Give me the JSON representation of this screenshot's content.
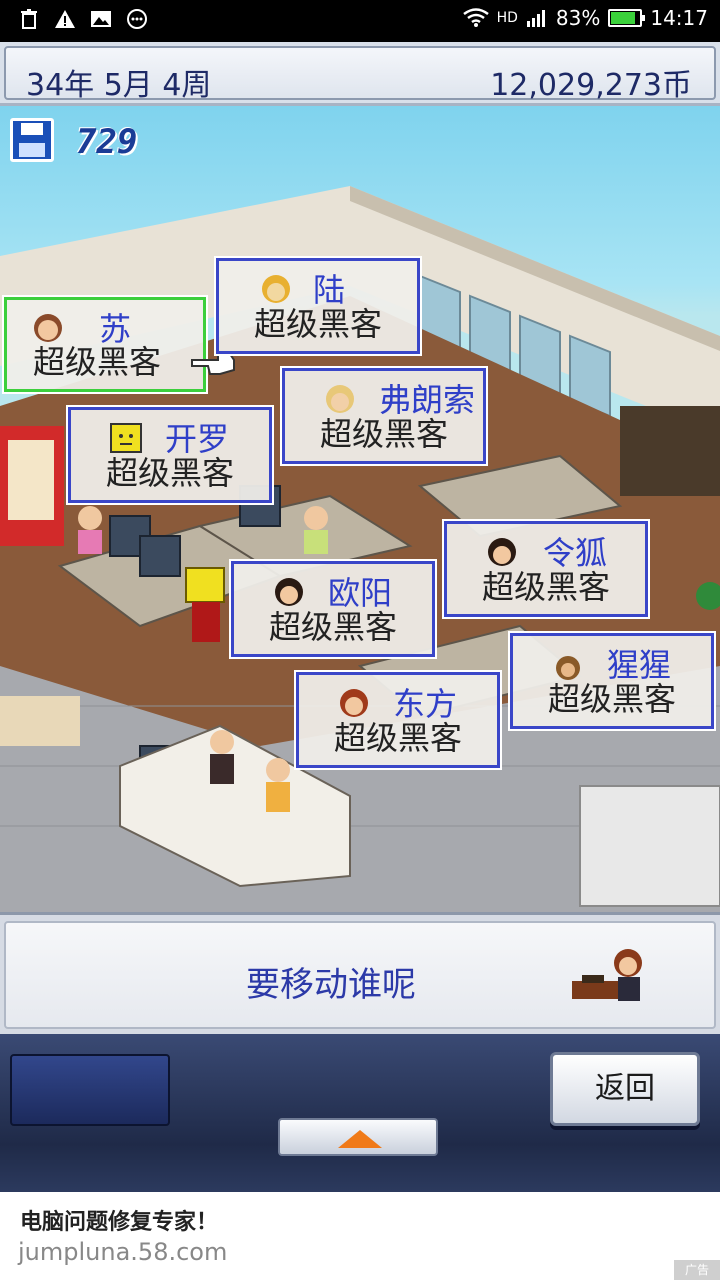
{
  "status_bar": {
    "battery": "83%",
    "battery_level": 0.83,
    "time": "14:17",
    "network": "HD"
  },
  "top_bar": {
    "date": "34年 5月 4周",
    "money": "12,029,273币"
  },
  "game": {
    "save_count": "729",
    "staff": [
      {
        "name": "苏",
        "role": "超级黑客",
        "selected": true
      },
      {
        "name": "陆",
        "role": "超级黑客"
      },
      {
        "name": "弗朗索",
        "role": "超级黑客"
      },
      {
        "name": "开罗",
        "role": "超级黑客"
      },
      {
        "name": "令狐",
        "role": "超级黑客"
      },
      {
        "name": "欧阳",
        "role": "超级黑客"
      },
      {
        "name": "猩猩",
        "role": "超级黑客"
      },
      {
        "name": "东方",
        "role": "超级黑客"
      }
    ]
  },
  "prompt": {
    "text": "要移动谁呢"
  },
  "controls": {
    "back_label": "返回"
  },
  "ad": {
    "title": "电脑问题修复专家！",
    "url": "jumpluna.58.com",
    "tag": "广告"
  },
  "colors": {
    "card_border": "#3a46c8",
    "card_selected_border": "#3ccf3c",
    "name_text": "#2f3fc8",
    "prompt_text": "#2c3aa8"
  }
}
